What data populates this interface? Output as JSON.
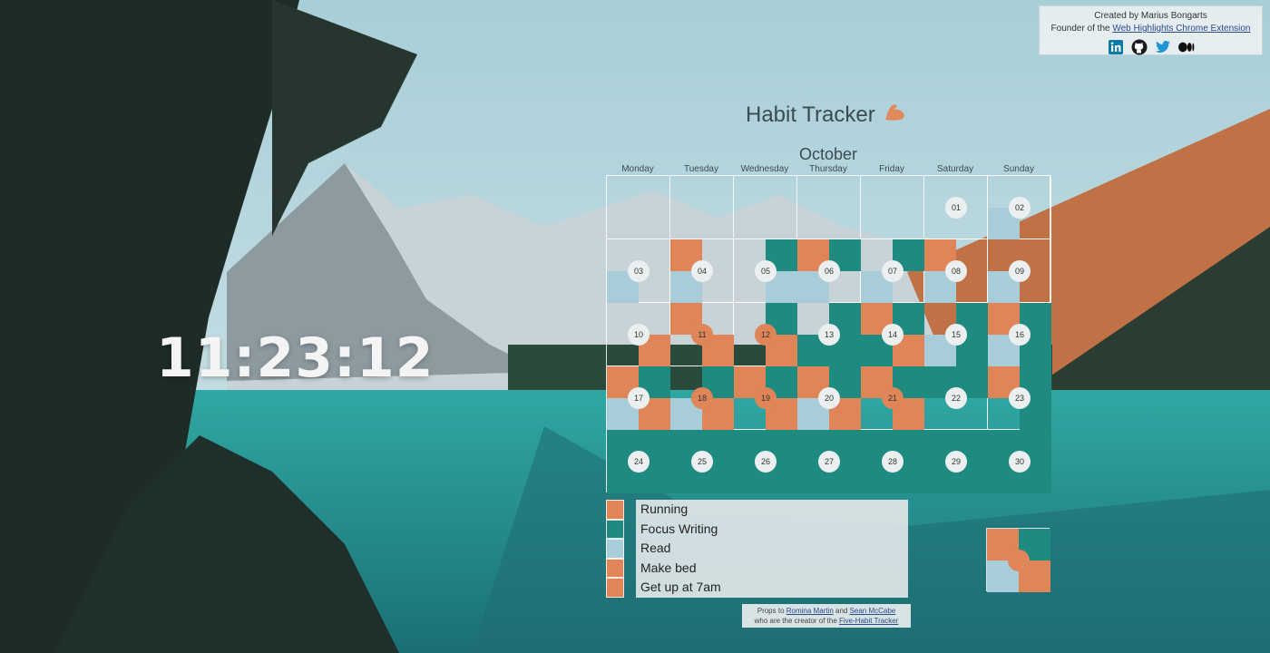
{
  "credit": {
    "line1": "Created by Marius Bongarts",
    "line2_prefix": "Founder of the ",
    "line2_link": "Web Highlights Chrome Extension",
    "social": [
      "linkedin-icon",
      "github-icon",
      "twitter-icon",
      "medium-icon"
    ]
  },
  "clock": "11:23:12",
  "title": "Habit Tracker",
  "title_icon": "flexed-biceps-icon",
  "month": "October",
  "weekdays": [
    "Monday",
    "Tuesday",
    "Wednesday",
    "Thursday",
    "Friday",
    "Saturday",
    "Sunday"
  ],
  "colors": {
    "running": "#df8558",
    "focus_writing": "#1f8a80",
    "read": "#a8cdd9",
    "make_bed": "#df8558",
    "get_up": "#df8558"
  },
  "days": [
    {
      "num": "01",
      "col": 5,
      "row": 0,
      "q": [
        null,
        null,
        null,
        null
      ],
      "orange": false
    },
    {
      "num": "02",
      "col": 6,
      "row": 0,
      "q": [
        null,
        null,
        "read",
        null
      ],
      "orange": false
    },
    {
      "num": "03",
      "col": 0,
      "row": 1,
      "q": [
        null,
        null,
        "read",
        null
      ],
      "orange": false
    },
    {
      "num": "04",
      "col": 1,
      "row": 1,
      "q": [
        "running",
        null,
        "read",
        null
      ],
      "orange": false
    },
    {
      "num": "05",
      "col": 2,
      "row": 1,
      "q": [
        null,
        "teal",
        null,
        "read"
      ],
      "orange": false
    },
    {
      "num": "06",
      "col": 3,
      "row": 1,
      "q": [
        "running",
        "teal",
        "read",
        null
      ],
      "orange": false
    },
    {
      "num": "07",
      "col": 4,
      "row": 1,
      "q": [
        null,
        "teal",
        "read",
        null
      ],
      "orange": false
    },
    {
      "num": "08",
      "col": 5,
      "row": 1,
      "q": [
        "running",
        null,
        "read",
        null
      ],
      "orange": false
    },
    {
      "num": "09",
      "col": 6,
      "row": 1,
      "q": [
        null,
        null,
        "read",
        null
      ],
      "orange": false
    },
    {
      "num": "10",
      "col": 0,
      "row": 2,
      "q": [
        null,
        null,
        null,
        "running"
      ],
      "orange": false
    },
    {
      "num": "11",
      "col": 1,
      "row": 2,
      "q": [
        "running",
        null,
        null,
        "running"
      ],
      "orange": true
    },
    {
      "num": "12",
      "col": 2,
      "row": 2,
      "q": [
        null,
        "teal",
        null,
        "running"
      ],
      "orange": true
    },
    {
      "num": "13",
      "col": 3,
      "row": 2,
      "q": [
        null,
        "teal",
        "teal",
        "teal"
      ],
      "orange": false
    },
    {
      "num": "14",
      "col": 4,
      "row": 2,
      "q": [
        "running",
        "teal",
        "teal",
        "running"
      ],
      "orange": false
    },
    {
      "num": "15",
      "col": 5,
      "row": 2,
      "q": [
        null,
        "teal",
        "read",
        "teal"
      ],
      "orange": false
    },
    {
      "num": "16",
      "col": 6,
      "row": 2,
      "q": [
        "running",
        "teal",
        "read",
        "teal"
      ],
      "orange": false
    },
    {
      "num": "17",
      "col": 0,
      "row": 3,
      "q": [
        "running",
        "teal",
        "read",
        "running"
      ],
      "orange": false
    },
    {
      "num": "18",
      "col": 1,
      "row": 3,
      "q": [
        null,
        "teal",
        "read",
        "running"
      ],
      "orange": true
    },
    {
      "num": "19",
      "col": 2,
      "row": 3,
      "q": [
        "running",
        "teal",
        null,
        "running"
      ],
      "orange": true
    },
    {
      "num": "20",
      "col": 3,
      "row": 3,
      "q": [
        "running",
        "teal",
        "read",
        "running"
      ],
      "orange": false
    },
    {
      "num": "21",
      "col": 4,
      "row": 3,
      "q": [
        "running",
        "teal",
        null,
        "running"
      ],
      "orange": true
    },
    {
      "num": "22",
      "col": 5,
      "row": 3,
      "q": [
        "teal",
        "teal",
        null,
        null
      ],
      "orange": false
    },
    {
      "num": "23",
      "col": 6,
      "row": 3,
      "q": [
        "running",
        "teal",
        null,
        "teal"
      ],
      "orange": false
    },
    {
      "num": "24",
      "col": 0,
      "row": 4,
      "q": [
        "teal",
        "teal",
        "teal",
        "teal"
      ],
      "orange": false
    },
    {
      "num": "25",
      "col": 1,
      "row": 4,
      "q": [
        "teal",
        "teal",
        "teal",
        "teal"
      ],
      "orange": false
    },
    {
      "num": "26",
      "col": 2,
      "row": 4,
      "q": [
        "teal",
        "teal",
        "teal",
        "teal"
      ],
      "orange": false
    },
    {
      "num": "27",
      "col": 3,
      "row": 4,
      "q": [
        "teal",
        "teal",
        "teal",
        "teal"
      ],
      "orange": false
    },
    {
      "num": "28",
      "col": 4,
      "row": 4,
      "q": [
        "teal",
        "teal",
        "teal",
        "teal"
      ],
      "orange": false
    },
    {
      "num": "29",
      "col": 5,
      "row": 4,
      "q": [
        "teal",
        "teal",
        "teal",
        "teal"
      ],
      "orange": false
    },
    {
      "num": "30",
      "col": 6,
      "row": 4,
      "q": [
        "teal",
        "teal",
        "teal",
        "teal"
      ],
      "orange": false
    }
  ],
  "legend": [
    {
      "label": "Running",
      "color": "#df8558"
    },
    {
      "label": "Focus Writing",
      "color": "#1f8a80"
    },
    {
      "label": "Read",
      "color": "#a8cdd9"
    },
    {
      "label": "Make bed",
      "color": "#df8558"
    },
    {
      "label": "Get up at 7am",
      "color": "#df8558"
    }
  ],
  "props": {
    "prefix": "Props to ",
    "name1": "Romina Martin",
    "and": " and ",
    "name2": "Sean McCabe",
    "line2_prefix": "who are the creator of the ",
    "link": "Five-Habit Tracker"
  }
}
